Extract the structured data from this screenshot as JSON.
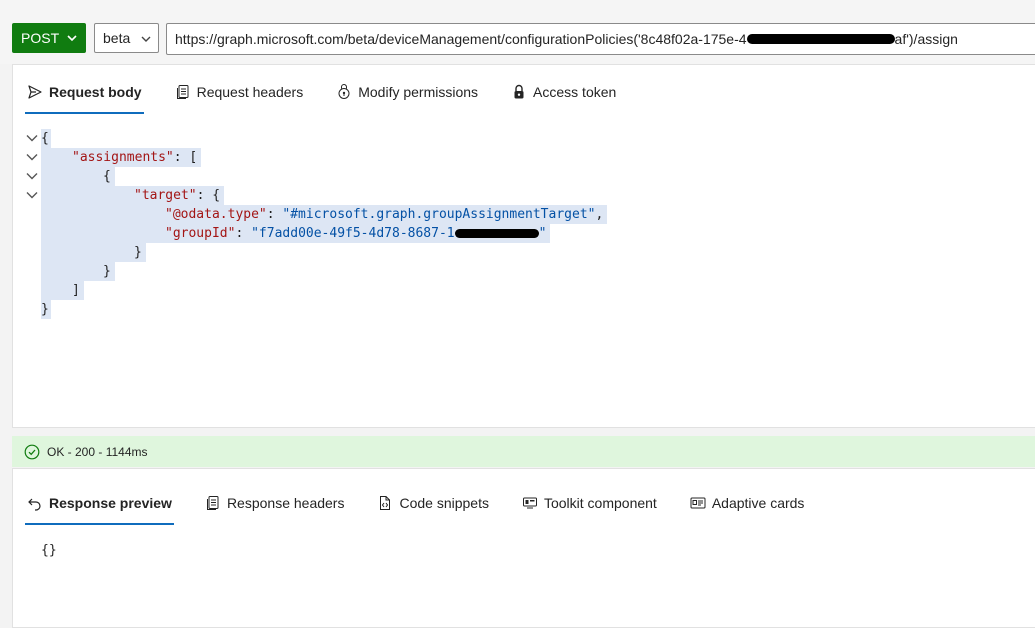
{
  "request": {
    "method": "POST",
    "version": "beta",
    "url_start": "https://graph.microsoft.com/beta/deviceManagement/configurationPolicies('8c48f02a-175e-4",
    "url_end": "af')/assign"
  },
  "request_tabs": [
    {
      "label": "Request body",
      "icon": "send-icon"
    },
    {
      "label": "Request headers",
      "icon": "document-icon"
    },
    {
      "label": "Modify permissions",
      "icon": "permissions-icon"
    },
    {
      "label": "Access token",
      "icon": "lock-icon"
    }
  ],
  "json_body": {
    "open": "{",
    "assignments_key": "\"assignments\"",
    "open_array": "[",
    "open_obj": "{",
    "target_key": "\"target\"",
    "odata_key": "\"@odata.type\"",
    "odata_val": "\"#microsoft.graph.groupAssignmentTarget\"",
    "group_key": "\"groupId\"",
    "group_val_start": "\"f7add00e-49f5-4d78-8687-1",
    "group_val_end": "\"",
    "close_inner": "}",
    "close_obj": "}",
    "close_array": "]",
    "close": "}"
  },
  "status": {
    "text": "OK - 200 - 1144ms",
    "color": "#dff6dd"
  },
  "response_tabs": [
    {
      "label": "Response preview",
      "icon": "undo-icon"
    },
    {
      "label": "Response headers",
      "icon": "document-icon"
    },
    {
      "label": "Code snippets",
      "icon": "code-icon"
    },
    {
      "label": "Toolkit component",
      "icon": "toolkit-icon"
    },
    {
      "label": "Adaptive cards",
      "icon": "card-icon"
    }
  ],
  "response_body": "{}",
  "colors": {
    "method_bg": "#107c10",
    "tab_underline": "#0f6cbd",
    "selection": "#dde6f4",
    "json_key": "#a31515",
    "json_string": "#0451a5"
  }
}
